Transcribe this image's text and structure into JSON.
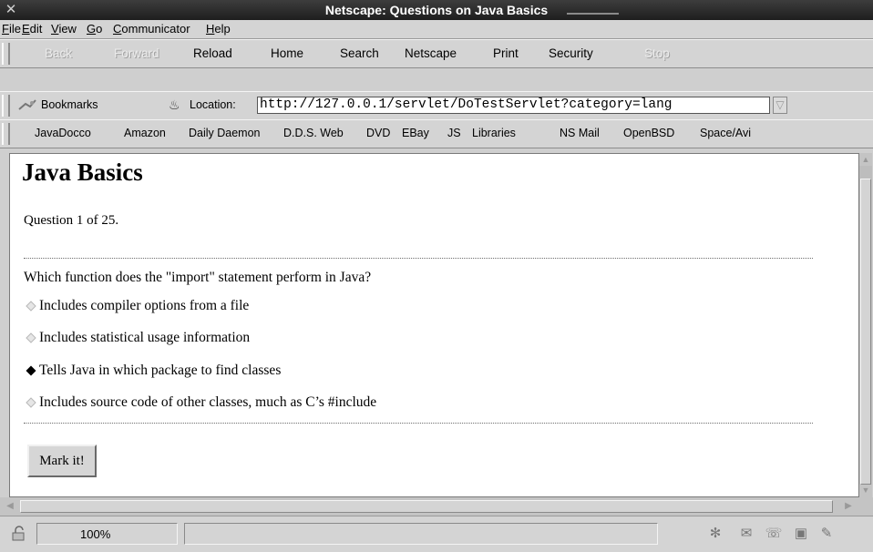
{
  "window": {
    "title": "Netscape: Questions on Java Basics"
  },
  "menu": {
    "items": [
      {
        "first": "F",
        "rest": "ile"
      },
      {
        "first": "E",
        "rest": "dit"
      },
      {
        "first": "V",
        "rest": "iew"
      },
      {
        "first": "G",
        "rest": "o"
      },
      {
        "first": "C",
        "rest": "ommunicator"
      },
      {
        "first": "H",
        "rest": "elp"
      }
    ]
  },
  "navbar": {
    "back": "Back",
    "forward": "Forward",
    "reload": "Reload",
    "home": "Home",
    "search": "Search",
    "netscape": "Netscape",
    "print": "Print",
    "security": "Security",
    "stop": "Stop"
  },
  "location": {
    "bookmarks_label": "Bookmarks",
    "label": "Location:",
    "url": "http://127.0.0.1/servlet/DoTestServlet?category=lang"
  },
  "links": [
    "JavaDocco",
    "Amazon",
    "Daily Daemon",
    "D.D.S. Web",
    "DVD",
    "EBay",
    "JS",
    "Libraries",
    "NS Mail",
    "OpenBSD",
    "Space/Avi"
  ],
  "page": {
    "title": "Java Basics",
    "question_count": "Question 1 of 25.",
    "question": "Which function does the \"import\" statement perform in Java?",
    "options": [
      {
        "label": "Includes compiler options from a file",
        "selected": false
      },
      {
        "label": "Includes statistical usage information",
        "selected": false
      },
      {
        "label": "Tells Java in which package to find classes",
        "selected": true
      },
      {
        "label": "Includes source code of other classes, much as C’s #include",
        "selected": false
      }
    ],
    "submit_label": "Mark it!"
  },
  "status": {
    "zoom": "100%"
  },
  "colors": {
    "title_bar": "#2b2b2b",
    "chrome": "#d4d4d4",
    "content_bg": "#ffffff"
  }
}
